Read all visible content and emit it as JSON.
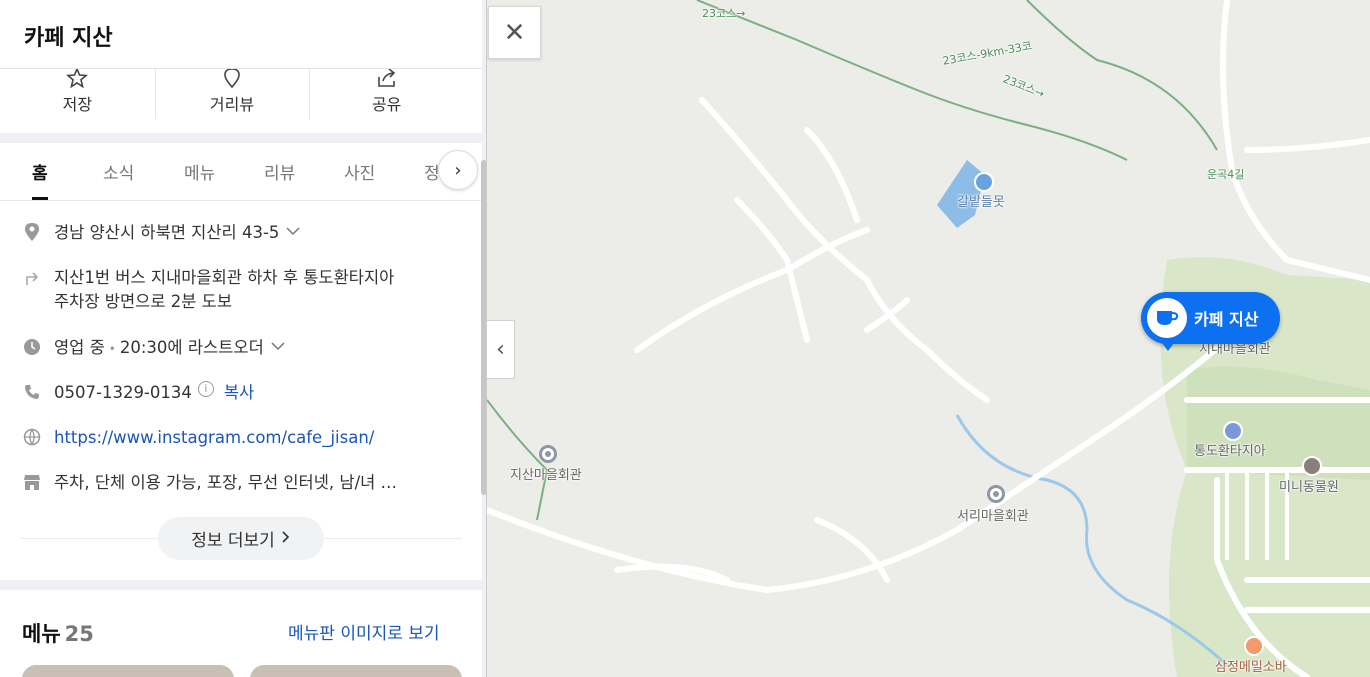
{
  "place": {
    "title": "카페 지산"
  },
  "actions": [
    {
      "label": "저장",
      "icon": "star-icon"
    },
    {
      "label": "거리뷰",
      "icon": "streetview-pin-icon"
    },
    {
      "label": "공유",
      "icon": "share-icon"
    }
  ],
  "tabs": [
    "홈",
    "소식",
    "메뉴",
    "리뷰",
    "사진",
    "정"
  ],
  "info": {
    "address": "경남 양산시 하북면 지산리 43-5",
    "directions_line1": "지산1번 버스 지내마을회관 하차 후 통도환타지아",
    "directions_line2": "주차장 방면으로 2분 도보",
    "hours_status": "영업 중",
    "hours_detail": "20:30에 라스트오더",
    "phone": "0507-1329-0134",
    "info_i": "i",
    "copy_label": "복사",
    "website": "https://www.instagram.com/cafe_jisan/",
    "amenities": "주차, 단체 이용 가능, 포장, 무선 인터넷, 남/녀 …",
    "more_label": "정보 더보기"
  },
  "menu": {
    "title": "메뉴",
    "count": "25",
    "image_link": "메뉴판 이미지로 보기"
  },
  "map": {
    "marker_label": "카페 지산",
    "labels": {
      "pond": "갈밭들못",
      "jisan_hall": "지산마을회관",
      "seori_hall": "서리마을회관",
      "tongdo": "통도환타지아",
      "mini_zoo": "미니동물원",
      "samjeong": "삼정메밀소바",
      "ungok": "운곡4길",
      "jinae_hall": "지내마을회관",
      "trail_1": "23코스-9km-33코",
      "trail_2": "23코스→",
      "trail_3": "23코스→"
    }
  },
  "controls": {
    "close": "✕",
    "collapse": "‹",
    "tab_next": "›"
  },
  "colors": {
    "accent": "#0d70f0",
    "link": "#1a55b8"
  }
}
